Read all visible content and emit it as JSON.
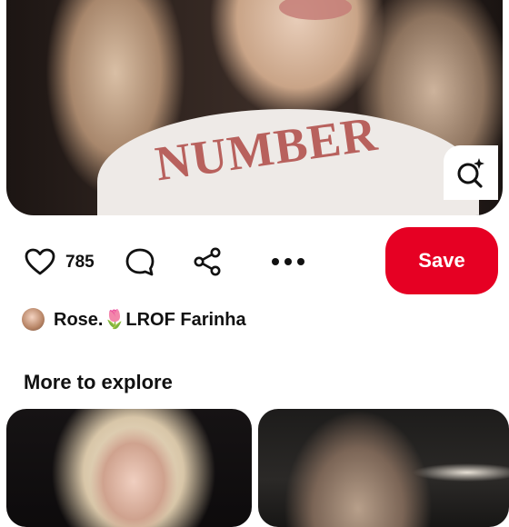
{
  "pin": {
    "image_alt": "",
    "shirt_text": "NUMBER"
  },
  "actions": {
    "like_count": "785",
    "save_label": "Save",
    "icons": {
      "like": "heart-icon",
      "comment": "comment-icon",
      "share": "share-icon",
      "more": "more-icon",
      "lens": "visual-search-icon"
    }
  },
  "creator": {
    "name": "Rose.🌷LROF Farinha"
  },
  "explore": {
    "title": "More to explore"
  },
  "colors": {
    "save_button": "#e60023",
    "text": "#111111",
    "background": "#ffffff"
  }
}
